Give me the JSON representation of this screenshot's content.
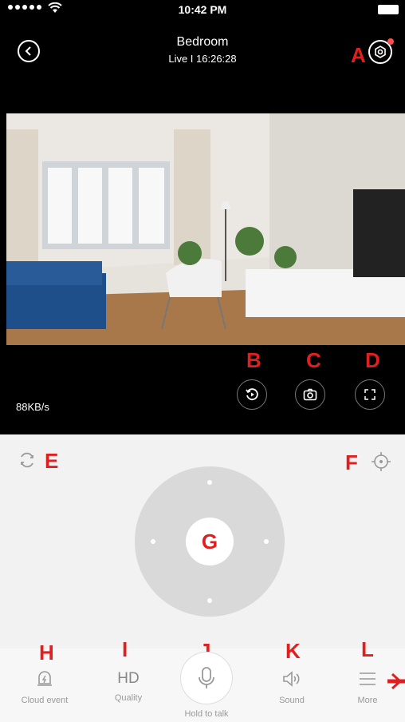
{
  "status": {
    "time": "10:42 PM"
  },
  "header": {
    "title": "Bedroom",
    "subtitle": "Live I 16:26:28"
  },
  "video": {
    "bitrate": "88KB/s"
  },
  "labels": {
    "a": "A",
    "b": "B",
    "c": "C",
    "d": "D",
    "e": "E",
    "f": "F",
    "g": "G",
    "h": "H",
    "i": "I",
    "j": "J",
    "k": "K",
    "l": "L"
  },
  "tabs": {
    "cloud_event": "Cloud event",
    "quality_value": "HD",
    "quality": "Quality",
    "hold_to_talk": "Hold to talk",
    "sound": "Sound",
    "more": "More"
  },
  "colors": {
    "accent_red": "#e02020",
    "ptz_bg": "#f2f2f2",
    "joystick": "#d9d9d9"
  }
}
